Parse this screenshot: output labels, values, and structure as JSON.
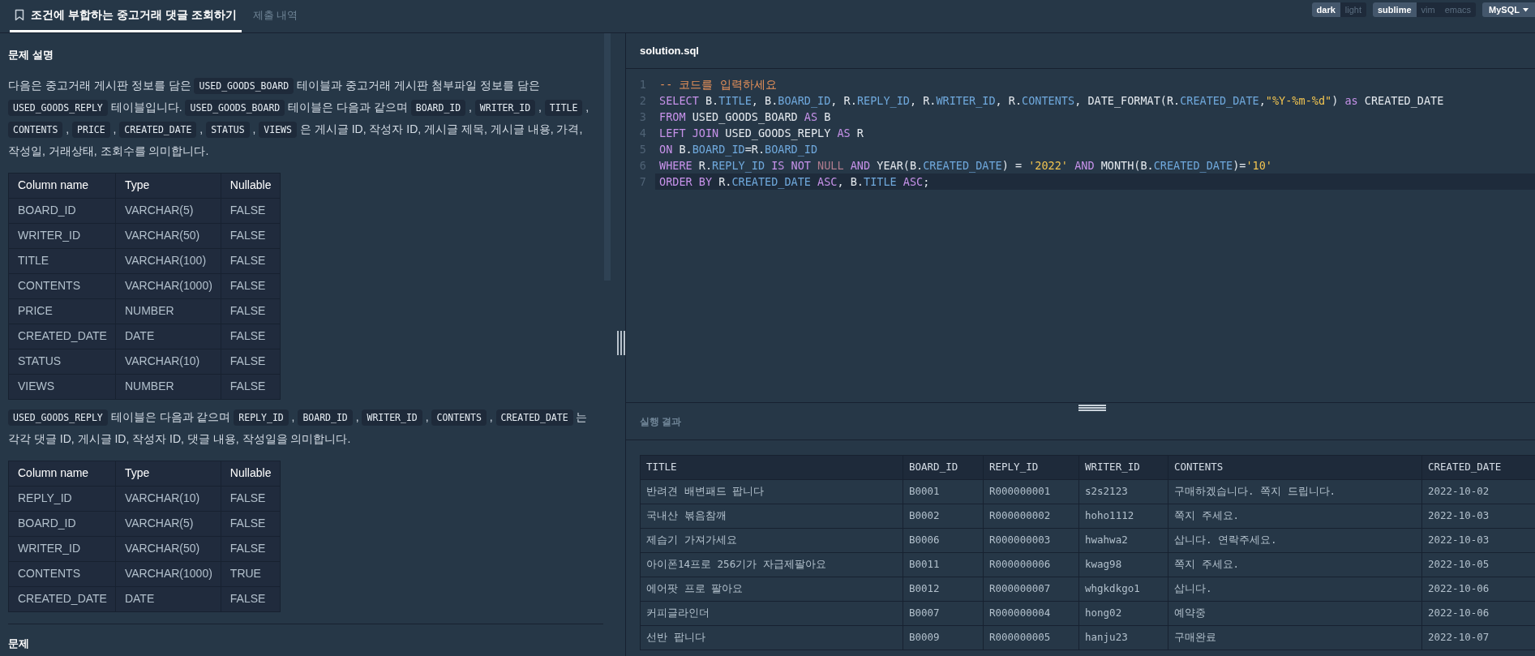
{
  "tabs": [
    {
      "label": "조건에 부합하는 중고거래 댓글 조회하기",
      "selected": true
    },
    {
      "label": "제출 내역",
      "selected": false
    }
  ],
  "theme_toggle": [
    {
      "label": "dark",
      "selected": true
    },
    {
      "label": "light",
      "selected": false
    }
  ],
  "keymap_toggle": [
    {
      "label": "sublime",
      "selected": true
    },
    {
      "label": "vim",
      "selected": false
    },
    {
      "label": "emacs",
      "selected": false
    }
  ],
  "language_dropdown": {
    "value": "MySQL"
  },
  "description": {
    "heading": "문제 설명",
    "paragraph_1": [
      {
        "kind": "text",
        "text": "다음은 중고거래 게시판 정보를 담은 "
      },
      {
        "kind": "code",
        "text": "USED_GOODS_BOARD"
      },
      {
        "kind": "text",
        "text": " 테이블과 중고거래 게시판 첨부파일 정보를 담은 "
      },
      {
        "kind": "code",
        "text": "USED_GOODS_REPLY"
      },
      {
        "kind": "text",
        "text": " 테이블입니다. "
      },
      {
        "kind": "code",
        "text": "USED_GOODS_BOARD"
      },
      {
        "kind": "text",
        "text": " 테이블은 다음과 같으며 "
      },
      {
        "kind": "code",
        "text": "BOARD_ID"
      },
      {
        "kind": "text",
        "text": " , "
      },
      {
        "kind": "code",
        "text": "WRITER_ID"
      },
      {
        "kind": "text",
        "text": " , "
      },
      {
        "kind": "code",
        "text": "TITLE"
      },
      {
        "kind": "text",
        "text": " , "
      },
      {
        "kind": "code",
        "text": "CONTENTS"
      },
      {
        "kind": "text",
        "text": " , "
      },
      {
        "kind": "code",
        "text": "PRICE"
      },
      {
        "kind": "text",
        "text": " , "
      },
      {
        "kind": "code",
        "text": "CREATED_DATE"
      },
      {
        "kind": "text",
        "text": " , "
      },
      {
        "kind": "code",
        "text": "STATUS"
      },
      {
        "kind": "text",
        "text": " , "
      },
      {
        "kind": "code",
        "text": "VIEWS"
      },
      {
        "kind": "text",
        "text": " 은 게시글 ID, 작성자 ID, 게시글 제목, 게시글 내용, 가격, 작성일, 거래상태, 조회수를 의미합니다."
      }
    ],
    "table_1": {
      "columns": [
        "Column name",
        "Type",
        "Nullable"
      ],
      "rows": [
        [
          "BOARD_ID",
          "VARCHAR(5)",
          "FALSE"
        ],
        [
          "WRITER_ID",
          "VARCHAR(50)",
          "FALSE"
        ],
        [
          "TITLE",
          "VARCHAR(100)",
          "FALSE"
        ],
        [
          "CONTENTS",
          "VARCHAR(1000)",
          "FALSE"
        ],
        [
          "PRICE",
          "NUMBER",
          "FALSE"
        ],
        [
          "CREATED_DATE",
          "DATE",
          "FALSE"
        ],
        [
          "STATUS",
          "VARCHAR(10)",
          "FALSE"
        ],
        [
          "VIEWS",
          "NUMBER",
          "FALSE"
        ]
      ]
    },
    "paragraph_2": [
      {
        "kind": "code",
        "text": "USED_GOODS_REPLY"
      },
      {
        "kind": "text",
        "text": " 테이블은 다음과 같으며 "
      },
      {
        "kind": "code",
        "text": "REPLY_ID"
      },
      {
        "kind": "text",
        "text": " , "
      },
      {
        "kind": "code",
        "text": "BOARD_ID"
      },
      {
        "kind": "text",
        "text": " , "
      },
      {
        "kind": "code",
        "text": "WRITER_ID"
      },
      {
        "kind": "text",
        "text": " , "
      },
      {
        "kind": "code",
        "text": "CONTENTS"
      },
      {
        "kind": "text",
        "text": " , "
      },
      {
        "kind": "code",
        "text": "CREATED_DATE"
      },
      {
        "kind": "text",
        "text": " 는 각각 댓글 ID, 게시글 ID, 작성자 ID, 댓글 내용, 작성일을 의미합니다."
      }
    ],
    "table_2": {
      "columns": [
        "Column name",
        "Type",
        "Nullable"
      ],
      "rows": [
        [
          "REPLY_ID",
          "VARCHAR(10)",
          "FALSE"
        ],
        [
          "BOARD_ID",
          "VARCHAR(5)",
          "FALSE"
        ],
        [
          "WRITER_ID",
          "VARCHAR(50)",
          "FALSE"
        ],
        [
          "CONTENTS",
          "VARCHAR(1000)",
          "TRUE"
        ],
        [
          "CREATED_DATE",
          "DATE",
          "FALSE"
        ]
      ]
    },
    "next_heading": "문제"
  },
  "editor": {
    "filename": "solution.sql",
    "lines": [
      {
        "number": "1",
        "active": false,
        "tokens": [
          {
            "kind": "comment",
            "text": "-- 코드를 입력하세요"
          }
        ]
      },
      {
        "number": "2",
        "active": false,
        "tokens": [
          {
            "kind": "keyword",
            "text": "SELECT"
          },
          {
            "kind": "plain",
            "text": " B."
          },
          {
            "kind": "field",
            "text": "TITLE"
          },
          {
            "kind": "plain",
            "text": ", B."
          },
          {
            "kind": "field",
            "text": "BOARD_ID"
          },
          {
            "kind": "plain",
            "text": ", R."
          },
          {
            "kind": "field",
            "text": "REPLY_ID"
          },
          {
            "kind": "plain",
            "text": ", R."
          },
          {
            "kind": "field",
            "text": "WRITER_ID"
          },
          {
            "kind": "plain",
            "text": ", R."
          },
          {
            "kind": "field",
            "text": "CONTENTS"
          },
          {
            "kind": "plain",
            "text": ", DATE_FORMAT(R."
          },
          {
            "kind": "field",
            "text": "CREATED_DATE"
          },
          {
            "kind": "plain",
            "text": ","
          },
          {
            "kind": "string",
            "text": "\"%Y-%m-%d\""
          },
          {
            "kind": "plain",
            "text": ") "
          },
          {
            "kind": "keyword",
            "text": "as"
          },
          {
            "kind": "plain",
            "text": " CREATED_DATE"
          }
        ]
      },
      {
        "number": "3",
        "active": false,
        "tokens": [
          {
            "kind": "keyword",
            "text": "FROM"
          },
          {
            "kind": "plain",
            "text": " USED_GOODS_BOARD "
          },
          {
            "kind": "keyword",
            "text": "AS"
          },
          {
            "kind": "plain",
            "text": " B"
          }
        ]
      },
      {
        "number": "4",
        "active": false,
        "tokens": [
          {
            "kind": "keyword",
            "text": "LEFT JOIN"
          },
          {
            "kind": "plain",
            "text": " USED_GOODS_REPLY "
          },
          {
            "kind": "keyword",
            "text": "AS"
          },
          {
            "kind": "plain",
            "text": " R"
          }
        ]
      },
      {
        "number": "5",
        "active": false,
        "tokens": [
          {
            "kind": "keyword",
            "text": "ON"
          },
          {
            "kind": "plain",
            "text": " B."
          },
          {
            "kind": "field",
            "text": "BOARD_ID"
          },
          {
            "kind": "plain",
            "text": "=R."
          },
          {
            "kind": "field",
            "text": "BOARD_ID"
          }
        ]
      },
      {
        "number": "6",
        "active": false,
        "tokens": [
          {
            "kind": "keyword",
            "text": "WHERE"
          },
          {
            "kind": "plain",
            "text": " R."
          },
          {
            "kind": "field",
            "text": "REPLY_ID"
          },
          {
            "kind": "keyword",
            "text": " IS NOT"
          },
          {
            "kind": "null",
            "text": " NULL"
          },
          {
            "kind": "keyword",
            "text": " AND"
          },
          {
            "kind": "plain",
            "text": " YEAR(B."
          },
          {
            "kind": "field",
            "text": "CREATED_DATE"
          },
          {
            "kind": "plain",
            "text": ") = "
          },
          {
            "kind": "string",
            "text": "'2022'"
          },
          {
            "kind": "keyword",
            "text": " AND"
          },
          {
            "kind": "plain",
            "text": " MONTH(B."
          },
          {
            "kind": "field",
            "text": "CREATED_DATE"
          },
          {
            "kind": "plain",
            "text": ")="
          },
          {
            "kind": "string",
            "text": "'10'"
          }
        ]
      },
      {
        "number": "7",
        "active": true,
        "tokens": [
          {
            "kind": "keyword",
            "text": "ORDER BY"
          },
          {
            "kind": "plain",
            "text": " R."
          },
          {
            "kind": "field",
            "text": "CREATED_DATE"
          },
          {
            "kind": "keyword",
            "text": " ASC"
          },
          {
            "kind": "plain",
            "text": ", B."
          },
          {
            "kind": "field",
            "text": "TITLE"
          },
          {
            "kind": "keyword",
            "text": " ASC"
          },
          {
            "kind": "plain",
            "text": ";"
          }
        ]
      }
    ]
  },
  "results": {
    "heading": "실행 결과",
    "columns": [
      "TITLE",
      "BOARD_ID",
      "REPLY_ID",
      "WRITER_ID",
      "CONTENTS",
      "CREATED_DATE"
    ],
    "rows": [
      [
        "반려견 배변패드 팝니다",
        "B0001",
        "R000000001",
        "s2s2123",
        "구매하겠습니다. 쪽지 드립니다.",
        "2022-10-02"
      ],
      [
        "국내산 볶음참깨",
        "B0002",
        "R000000002",
        "hoho1112",
        "쪽지 주세요.",
        "2022-10-03"
      ],
      [
        "제습기 가져가세요",
        "B0006",
        "R000000003",
        "hwahwa2",
        "삽니다. 연락주세요.",
        "2022-10-03"
      ],
      [
        "아이폰14프로 256기가 자급제팔아요",
        "B0011",
        "R000000006",
        "kwag98",
        "쪽지 주세요.",
        "2022-10-05"
      ],
      [
        "에어팟 프로 팔아요",
        "B0012",
        "R000000007",
        "whgkdkgo1",
        "삽니다.",
        "2022-10-06"
      ],
      [
        "커피글라인더",
        "B0007",
        "R000000004",
        "hong02",
        "예약중",
        "2022-10-06"
      ],
      [
        "선반 팝니다",
        "B0009",
        "R000000005",
        "hanju23",
        "구매완료",
        "2022-10-07"
      ]
    ]
  }
}
